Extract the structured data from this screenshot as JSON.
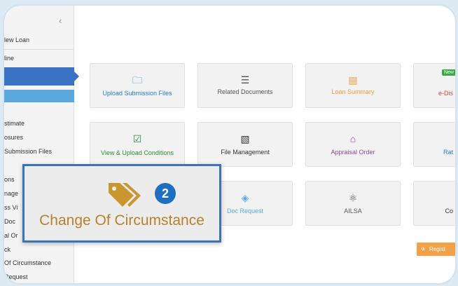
{
  "sidebar": {
    "collapse_glyph": "‹",
    "items": [
      {
        "label": "lew Loan"
      },
      {
        "label": "line"
      },
      {
        "label": "stimate"
      },
      {
        "label": "osures"
      },
      {
        "label": " Submission Files"
      },
      {
        "label": "ons"
      },
      {
        "label": "nage"
      },
      {
        "label": "ss Vi"
      },
      {
        "label": " Doc"
      },
      {
        "label": "al Or"
      },
      {
        "label": "ck"
      },
      {
        "label": " Of Circumstance"
      },
      {
        "label": " Request"
      }
    ]
  },
  "tiles": [
    {
      "label": "Upload Submission Files",
      "icon": "upload-folder-icon",
      "glyph": "🗀",
      "color": "#2f79c6"
    },
    {
      "label": "Related Documents",
      "icon": "documents-stack-icon",
      "glyph": "☰",
      "color": "#555555"
    },
    {
      "label": "Loan Summary",
      "icon": "summary-document-icon",
      "glyph": "▤",
      "color": "#f09a3e"
    },
    {
      "label": "e-Dis",
      "icon": "",
      "glyph": "",
      "color": "#e04040",
      "badge": "New"
    },
    {
      "label": "View & Upload Conditions",
      "icon": "checkbox-icon",
      "glyph": "☑",
      "color": "#2e8b3a"
    },
    {
      "label": "File Management",
      "icon": "file-copy-icon",
      "glyph": "▧",
      "color": "#333333"
    },
    {
      "label": "Appraisal Order",
      "icon": "home-icon",
      "glyph": "⌂",
      "color": "#8a4aa6"
    },
    {
      "label": "Rat",
      "icon": "",
      "glyph": "",
      "color": "#2f79c6"
    },
    {
      "label": "Doc Request",
      "icon": "layers-icon",
      "glyph": "◈",
      "color": "#5aa9dc"
    },
    {
      "label": "AILSA",
      "icon": "atom-icon",
      "glyph": "⚛",
      "color": "#555555"
    },
    {
      "label": "Co",
      "icon": "",
      "glyph": "",
      "color": "#333333"
    }
  ],
  "register_label": "Regist",
  "callout": {
    "step_number": "2",
    "title": "Change Of Circumstance",
    "icon": "tags-icon",
    "icon_color": "#c9962f"
  }
}
